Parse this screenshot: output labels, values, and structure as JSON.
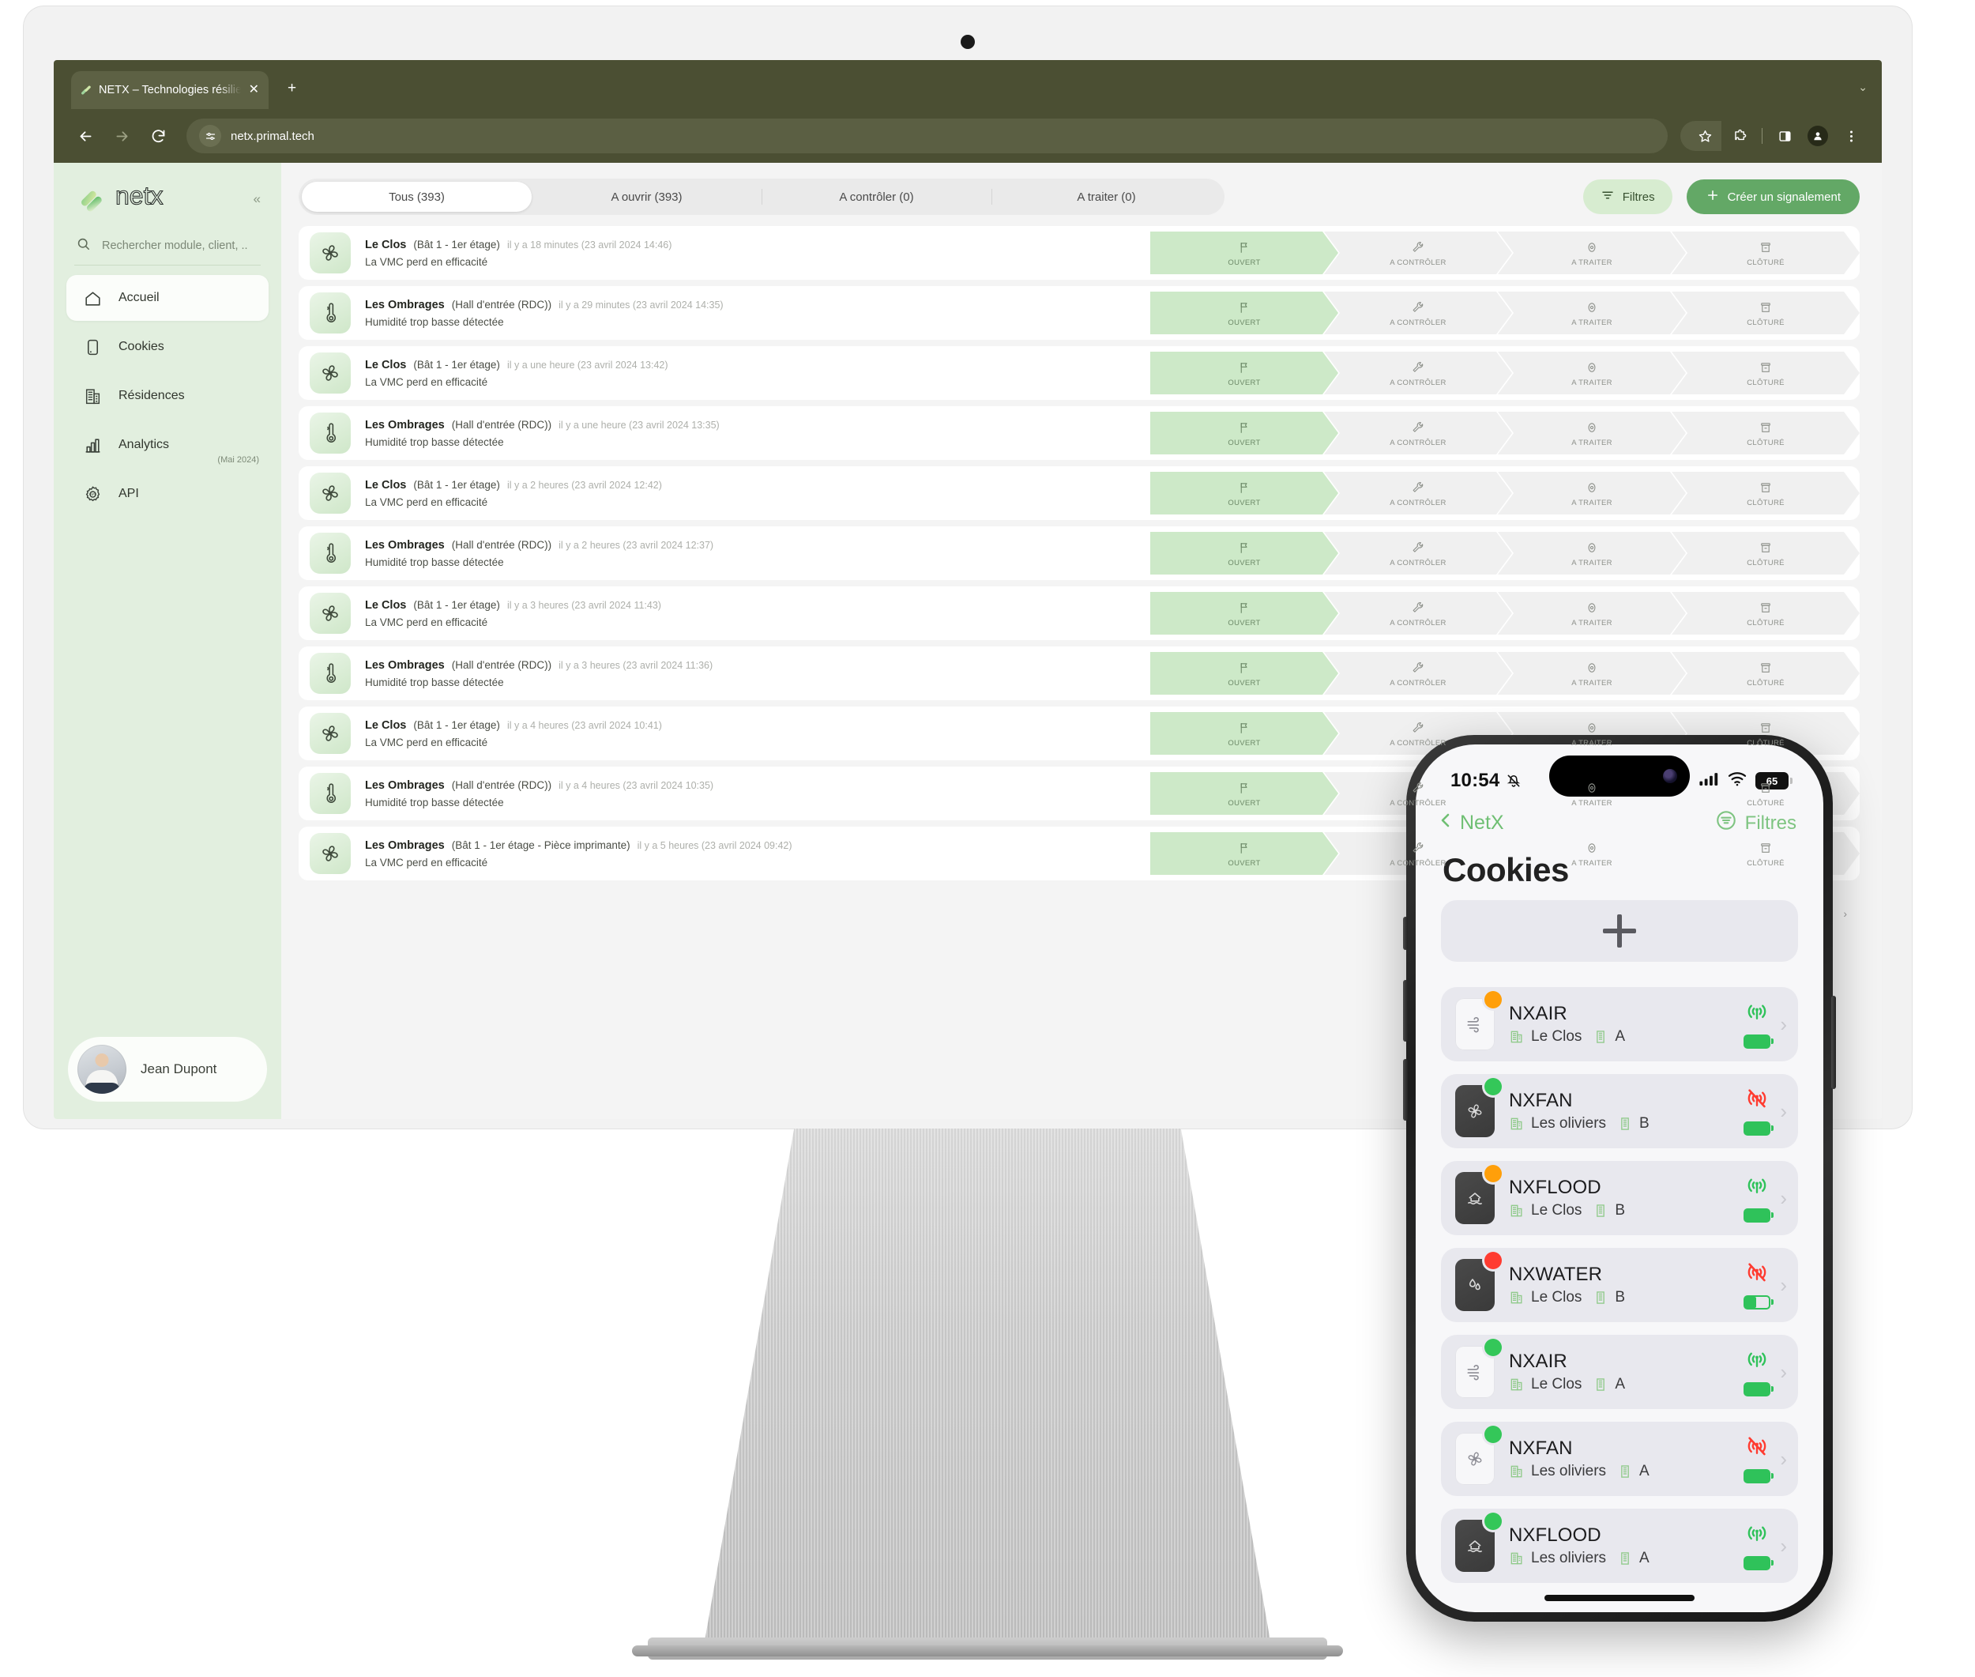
{
  "browser": {
    "tab_title": "NETX – Technologies résilient",
    "url": "netx.primal.tech",
    "new_tab_label": "+",
    "close_label": "✕"
  },
  "sidebar": {
    "brand": "netx",
    "collapse_label": "«",
    "search_placeholder": "Rechercher module, client, ..",
    "items": [
      {
        "label": "Accueil",
        "icon": "home-icon",
        "active": true,
        "sub": ""
      },
      {
        "label": "Cookies",
        "icon": "device-icon",
        "active": false,
        "sub": ""
      },
      {
        "label": "Résidences",
        "icon": "building-icon",
        "active": false,
        "sub": ""
      },
      {
        "label": "Analytics",
        "icon": "bar-chart-icon",
        "active": false,
        "sub": "(Mai 2024)"
      },
      {
        "label": "API",
        "icon": "gear-api-icon",
        "active": false,
        "sub": ""
      }
    ],
    "user": {
      "name": "Jean Dupont"
    }
  },
  "toolbar": {
    "tabs": [
      {
        "label": "Tous (393)",
        "active": true
      },
      {
        "label": "A ouvrir (393)",
        "active": false
      },
      {
        "label": "A contrôler (0)",
        "active": false
      },
      {
        "label": "A traiter (0)",
        "active": false
      }
    ],
    "filters_label": "Filtres",
    "create_label": "Créer un signalement"
  },
  "pipeline_steps": [
    {
      "label": "OUVERT",
      "icon": "flag-icon"
    },
    {
      "label": "A CONTRÔLER",
      "icon": "wrench-icon"
    },
    {
      "label": "A TRAITER",
      "icon": "eye-icon"
    },
    {
      "label": "CLÔTURÉ",
      "icon": "archive-icon"
    }
  ],
  "rows": [
    {
      "icon": "fan-icon",
      "residence": "Le Clos",
      "location": "(Bât 1 - 1er étage)",
      "time": "il y a 18 minutes (23 avril 2024 14:46)",
      "message": "La VMC perd en efficacité",
      "status": "OUVERT"
    },
    {
      "icon": "thermometer-icon",
      "residence": "Les Ombrages",
      "location": "(Hall d'entrée (RDC))",
      "time": "il y a 29 minutes (23 avril 2024 14:35)",
      "message": "Humidité trop basse détectée",
      "status": "OUVERT"
    },
    {
      "icon": "fan-icon",
      "residence": "Le Clos",
      "location": "(Bât 1 - 1er étage)",
      "time": "il y a une heure (23 avril 2024 13:42)",
      "message": "La VMC perd en efficacité",
      "status": "OUVERT"
    },
    {
      "icon": "thermometer-icon",
      "residence": "Les Ombrages",
      "location": "(Hall d'entrée (RDC))",
      "time": "il y a une heure (23 avril 2024 13:35)",
      "message": "Humidité trop basse détectée",
      "status": "OUVERT"
    },
    {
      "icon": "fan-icon",
      "residence": "Le Clos",
      "location": "(Bât 1 - 1er étage)",
      "time": "il y a 2 heures (23 avril 2024 12:42)",
      "message": "La VMC perd en efficacité",
      "status": "OUVERT"
    },
    {
      "icon": "thermometer-icon",
      "residence": "Les Ombrages",
      "location": "(Hall d'entrée (RDC))",
      "time": "il y a 2 heures (23 avril 2024 12:37)",
      "message": "Humidité trop basse détectée",
      "status": "OUVERT"
    },
    {
      "icon": "fan-icon",
      "residence": "Le Clos",
      "location": "(Bât 1 - 1er étage)",
      "time": "il y a 3 heures (23 avril 2024 11:43)",
      "message": "La VMC perd en efficacité",
      "status": "OUVERT"
    },
    {
      "icon": "thermometer-icon",
      "residence": "Les Ombrages",
      "location": "(Hall d'entrée (RDC))",
      "time": "il y a 3 heures (23 avril 2024 11:36)",
      "message": "Humidité trop basse détectée",
      "status": "OUVERT"
    },
    {
      "icon": "fan-icon",
      "residence": "Le Clos",
      "location": "(Bât 1 - 1er étage)",
      "time": "il y a 4 heures (23 avril 2024 10:41)",
      "message": "La VMC perd en efficacité",
      "status": "OUVERT"
    },
    {
      "icon": "thermometer-icon",
      "residence": "Les Ombrages",
      "location": "(Hall d'entrée (RDC))",
      "time": "il y a 4 heures (23 avril 2024 10:35)",
      "message": "Humidité trop basse détectée",
      "status": "OUVERT"
    },
    {
      "icon": "fan-icon",
      "residence": "Les Ombrages",
      "location": "(Bât 1 - 1er étage - Pièce imprimante)",
      "time": "il y a 5 heures (23 avril 2024 09:42)",
      "message": "La VMC perd en efficacité",
      "status": "OUVERT"
    }
  ],
  "phone": {
    "status": {
      "time": "10:54",
      "battery": "65"
    },
    "back_label": "NetX",
    "filters_label": "Filtres",
    "title": "Cookies",
    "add_label": "+",
    "devices": [
      {
        "name": "NXAIR",
        "residence": "Le Clos",
        "building": "A",
        "dot": "#ff9f0a",
        "icon": "air-icon",
        "icon_style": "light",
        "signal": "on",
        "battery_pct": 100
      },
      {
        "name": "NXFAN",
        "residence": "Les oliviers",
        "building": "B",
        "dot": "#34c759",
        "icon": "fan-icon",
        "icon_style": "dark",
        "signal": "off",
        "battery_pct": 100
      },
      {
        "name": "NXFLOOD",
        "residence": "Le Clos",
        "building": "B",
        "dot": "#ff9f0a",
        "icon": "flood-icon",
        "icon_style": "dark",
        "signal": "on",
        "battery_pct": 100
      },
      {
        "name": "NXWATER",
        "residence": "Le Clos",
        "building": "B",
        "dot": "#ff3b30",
        "icon": "water-icon",
        "icon_style": "dark",
        "signal": "off",
        "battery_pct": 45
      },
      {
        "name": "NXAIR",
        "residence": "Le Clos",
        "building": "A",
        "dot": "#34c759",
        "icon": "air-icon",
        "icon_style": "light",
        "signal": "on",
        "battery_pct": 100
      },
      {
        "name": "NXFAN",
        "residence": "Les oliviers",
        "building": "A",
        "dot": "#34c759",
        "icon": "fan-icon",
        "icon_style": "light",
        "signal": "off",
        "battery_pct": 100
      },
      {
        "name": "NXFLOOD",
        "residence": "Les oliviers",
        "building": "A",
        "dot": "#34c759",
        "icon": "flood-icon",
        "icon_style": "dark",
        "signal": "on",
        "battery_pct": 100
      }
    ]
  },
  "colors": {
    "brand_green": "#63a866",
    "sidebar_bg": "#e2efdf",
    "chrome": "#4b4f33",
    "step_active": "#cde9c8"
  }
}
